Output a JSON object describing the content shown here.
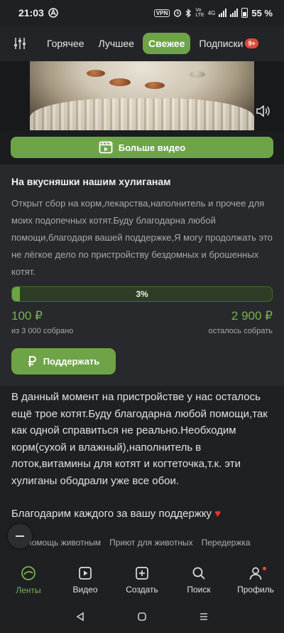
{
  "status_bar": {
    "time": "21:03",
    "vpn": "VPN",
    "network": "4G",
    "battery": "55 %"
  },
  "top_tabs": [
    {
      "label": "Горячее",
      "active": false
    },
    {
      "label": "Лучшее",
      "active": false
    },
    {
      "label": "Свежее",
      "active": true
    },
    {
      "label": "Подписки",
      "active": false,
      "badge": "9+"
    }
  ],
  "video": {
    "more_button": "Больше видео"
  },
  "fundraiser": {
    "title": "На вкусняшки нашим хулиганам",
    "description": "Открыт сбор на корм,лекарства,наполнитель и прочее для моих подопечных котят.Буду благодарна любой помощи,благодаря вашей поддержке,Я могу продолжать это не лёгкое дело по пристройству бездомных и брошенных котят.",
    "progress_percent": 3,
    "progress_label": "3%",
    "collected_amount": "100 ₽",
    "collected_caption": "из 3 000 собрано",
    "remaining_amount": "2 900 ₽",
    "remaining_caption": "осталось собрать",
    "support_button": "Поддержать"
  },
  "post": {
    "paragraph_1": "В данный момент на пристройстве у нас осталось ещё трое котят.Буду благодарна любой помощи,так как одной справиться не реально.Необходим корм(сухой и влажный),наполнитель в лоток,витамины для котят и когтеточка,т.к. эти хулиганы ободрали уже все обои.",
    "paragraph_2": "Благодарим каждого за вашу поддержку",
    "heart": "♥"
  },
  "tags": [
    "Помощь животным",
    "Приют для животных",
    "Передержка"
  ],
  "bottom_nav": [
    {
      "label": "Ленты",
      "icon": "feed-icon",
      "active": true
    },
    {
      "label": "Видео",
      "icon": "video-icon",
      "active": false
    },
    {
      "label": "Создать",
      "icon": "plus-square-icon",
      "active": false
    },
    {
      "label": "Поиск",
      "icon": "search-icon",
      "active": false
    },
    {
      "label": "Профиль",
      "icon": "profile-icon",
      "active": false,
      "has_notification": true
    }
  ],
  "colors": {
    "accent": "#6ea447",
    "amount_green": "#79b34e",
    "background": "#1f2022",
    "card_background": "#28292c"
  }
}
